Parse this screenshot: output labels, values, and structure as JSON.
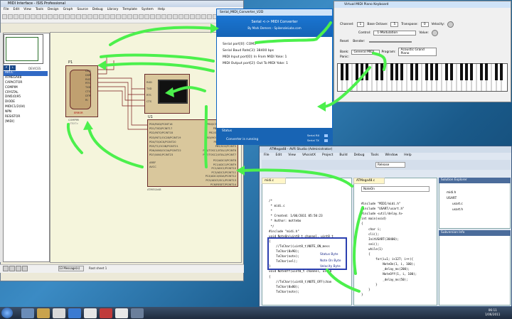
{
  "proteus": {
    "title": "MIDI Interface - ISIS Professional",
    "menu": [
      "File",
      "Edit",
      "View",
      "Tools",
      "Design",
      "Graph",
      "Source",
      "Debug",
      "Library",
      "Template",
      "System",
      "Help"
    ],
    "devices_header": "DEVICES",
    "devices": [
      "AVCC",
      "ATMEGA48",
      "CAPACITOR",
      "COMPIM",
      "CRYSTAL",
      "DIN5(0)95",
      "DIODE",
      "MIDIC1/2(04)",
      "NPN",
      "RESISTOR",
      "[MIDI]"
    ],
    "selected_device": "AVCC",
    "messages": "13 Message(s)",
    "status": "Root sheet 1",
    "p1_label": "P1",
    "p1_pins": [
      "DCD",
      "DSR",
      "RXD",
      "RTS",
      "TXD",
      "CTS",
      "DTR",
      "RI"
    ],
    "p1_name": "COMPIM",
    "p1_sub": "<TEXT>",
    "error_lbl": "ERROR",
    "u1_label": "U1",
    "u1_name": "ATMEGA48",
    "u1_left": [
      "PD0/RXD/PCINT16",
      "PD1/TXD/PCINT17",
      "PD2/INT0/PCINT18",
      "PD3/INT1/OC2B/PCINT19",
      "PD4/T0/XCK/PCINT20",
      "PD5/T1/OC0B/PCINT21",
      "PD6/AIN0/OC0A/PCINT22",
      "PD7/AIN1/PCINT23"
    ],
    "u1_right": [
      "PB0/ICP1/CLKO/PCINT0",
      "PB1/OC1A/PCINT1",
      "PB2/SS/OC1B/PCINT2",
      "PB3/MOSI/OC2A/PCINT3",
      "PB4/MISO/PCINT4",
      "PB5/SCK/PCINT5",
      "PB6/TOSC1/XTAL1/PCINT6",
      "PB7/TOSC2/XTAL2/PCINT7"
    ],
    "u1_right2": [
      "PC0/ADC0/PCINT8",
      "PC1/ADC1/PCINT9",
      "PC2/ADC2/PCINT10",
      "PC3/ADC3/PCINT11",
      "PC4/ADC4/SDA/PCINT12",
      "PC5/ADC5/SCL/PCINT13",
      "PC6/RESET/PCINT14"
    ],
    "u1_aref": "AREF",
    "u1_avcc": "AVCC",
    "vt_pins": [
      "RXD",
      "TXD",
      "RTS",
      "CTS"
    ]
  },
  "serial": {
    "title": "Serial_MIDI_Converter_V2D",
    "header1": "Serial <-> MIDI Converter",
    "header2": "By Mark Demers - SpikenzieLabs.com",
    "lines": [
      "Serial port[0]: COM1",
      "Serial Baud Rate[3]: 38400 bps",
      "MIDI Input port[0]: In From MIDI Yoke: 1",
      "MIDI Output port[2]: Out To MIDI Yoke: 1"
    ],
    "status_label": "Status",
    "status_text": "Converter is running",
    "serial_rx": "Serial RX",
    "serial_tx": "Serial TX"
  },
  "piano": {
    "title": "Virtual MIDI Piano Keyboard",
    "channel_label": "Channel:",
    "channel": "1",
    "octave_label": "Base Octave:",
    "octave": "5",
    "transpose_label": "Transpose:",
    "transpose": "0",
    "velocity_label": "Velocity:",
    "control_label": "Control:",
    "control": "1-Modulation",
    "value_label": "Value:",
    "reset_label": "Reset",
    "bender_label": "Bender:",
    "bank_label": "Bank:",
    "bank": "General MIDI",
    "program_label": "Program:",
    "program": "Acoustic Grand Piano",
    "panic_label": "Panic:"
  },
  "avr": {
    "title": "ATMega48 - AVR Studio (Administrator)",
    "menu": [
      "File",
      "Edit",
      "View",
      "VAssistX",
      "Project",
      "Build",
      "Debug",
      "Tools",
      "Window",
      "Help"
    ],
    "config": "Release",
    "tab_left": "midi.c",
    "tab_right": "ATMega48.c",
    "func_select": "NoteOn",
    "left_code": [
      "/*",
      " * midi.c",
      " *",
      " * Created: 1/06/2011 05:50:23",
      " * Author: mottebo",
      " */",
      "",
      "#include \"midi.h\"",
      "",
      "void NoteOn(uint8_t channel, uint8_t",
      "{",
      "    //TxChar((uint8_t)NOTE_ON_mess",
      "    TxChar(0x90);",
      "    TxChar(note);",
      "    TxChar(vel);",
      "}",
      "",
      "void NoteOff(uint8_t channel, uint8",
      "{",
      "    //TxChar((uint8_t)NOTE_OFF(chan",
      "    TxChar(0x80);",
      "    TxChar(note);",
      "    TxChar(vel);"
    ],
    "right_code": [
      "#include \"MIDI/midi.h\"",
      "#include \"USART/usart.h\"",
      "#include <util/delay.h>",
      "",
      "int main(void)",
      "{",
      "    char i;",
      "    cli();",
      "    InitUSART(38400);",
      "    sei();",
      "",
      "    while(1)",
      "    {",
      "        for(i=1; i<127; i++){",
      "            NoteOn(1, i, 100);",
      "            _delay_ms(200);",
      "            NoteOff(1, i, 100);",
      "            _delay_ms(50);",
      "        }",
      "    }",
      "}"
    ],
    "annotations": [
      "Status Byte",
      "Note On Byte",
      "Velocity Byte"
    ],
    "solution_title": "Solution Explorer",
    "solution_items": [
      "midi.h",
      "USART",
      "usart.c",
      "usart.h"
    ],
    "subversion_title": "Subversion Info"
  },
  "taskbar": {
    "time": "06:11",
    "date": "1/06/2011"
  },
  "colors": {
    "arrow": "#4cf04c",
    "highlight_box": "#2b3fb0",
    "win_blue": "#1864b4"
  }
}
